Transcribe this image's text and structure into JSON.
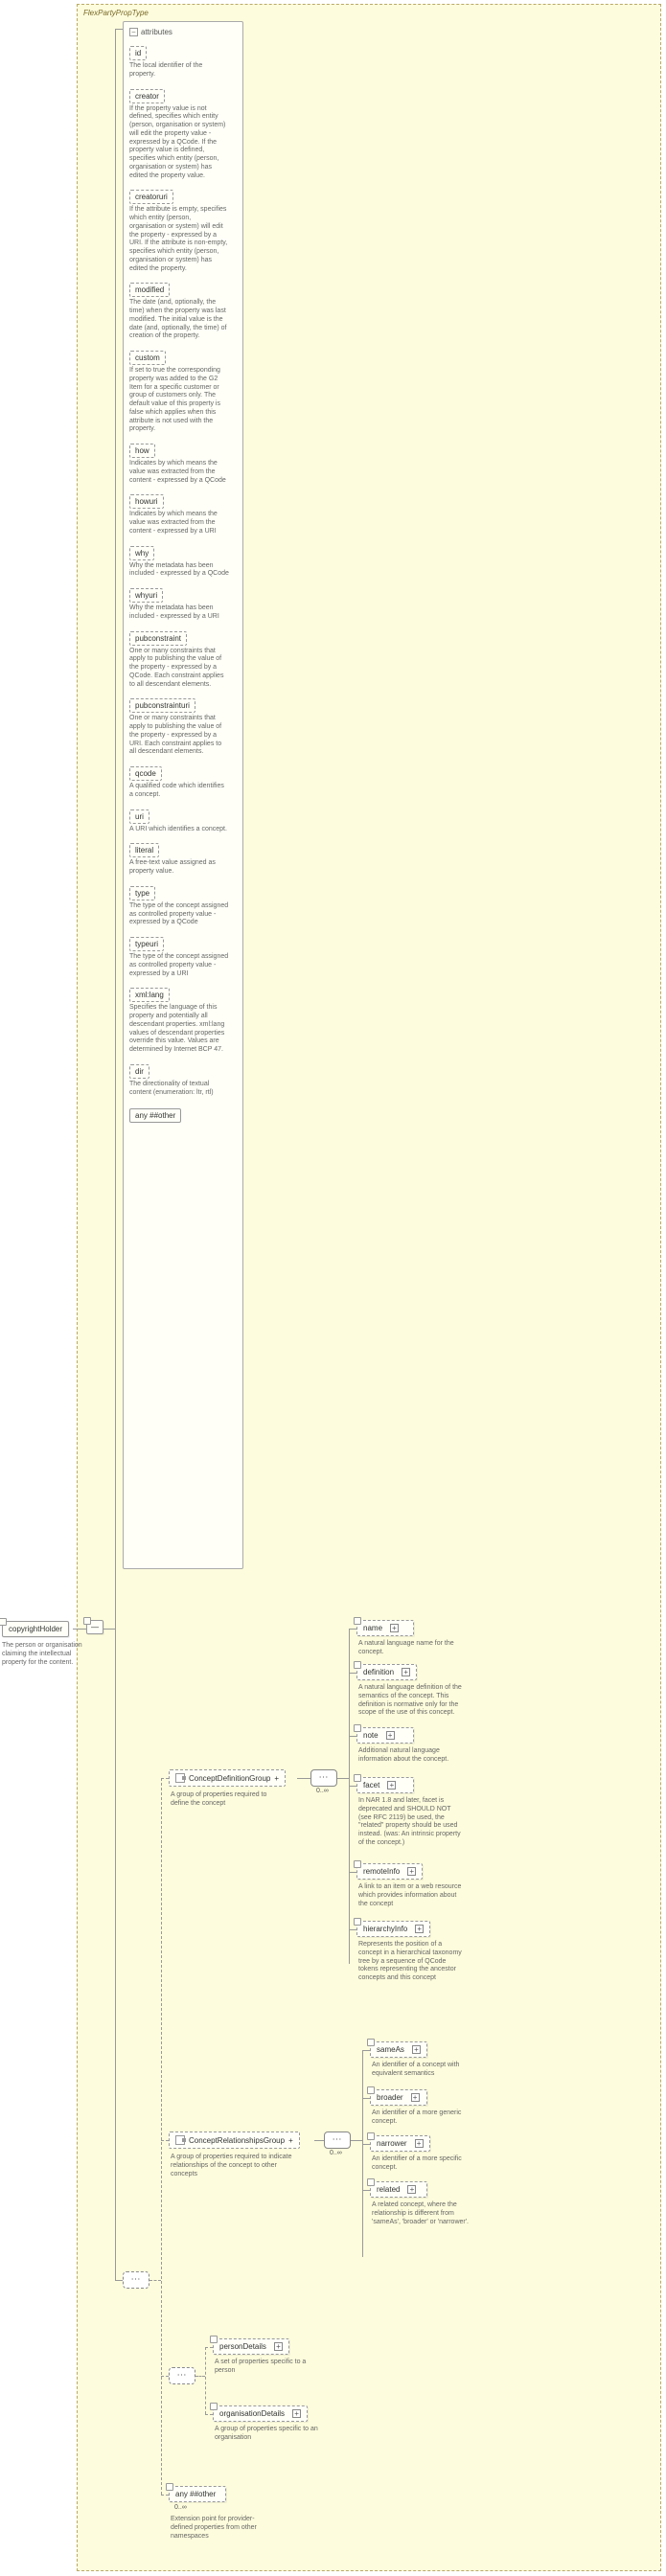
{
  "type_name": "FlexPartyPropType",
  "root": {
    "name": "copyrightHolder",
    "desc": "The person or organisation claiming the intellectual property for the content."
  },
  "attrs_header": "attributes",
  "attributes": [
    {
      "name": "id",
      "desc": "The local identifier of the property."
    },
    {
      "name": "creator",
      "desc": "If the property value is not defined, specifies which entity (person, organisation or system) will edit the property value - expressed by a QCode. If the property value is defined, specifies which entity (person, organisation or system) has edited the property value."
    },
    {
      "name": "creatoruri",
      "desc": "If the attribute is empty, specifies which entity (person, organisation or system) will edit the property - expressed by a URI. If the attribute is non-empty, specifies which entity (person, organisation or system) has edited the property."
    },
    {
      "name": "modified",
      "desc": "The date (and, optionally, the time) when the property was last modified. The initial value is the date (and, optionally, the time) of creation of the property."
    },
    {
      "name": "custom",
      "desc": "If set to true the corresponding property was added to the G2 Item for a specific customer or group of customers only. The default value of this property is false which applies when this attribute is not used with the property."
    },
    {
      "name": "how",
      "desc": "Indicates by which means the value was extracted from the content - expressed by a QCode"
    },
    {
      "name": "howuri",
      "desc": "Indicates by which means the value was extracted from the content - expressed by a URI"
    },
    {
      "name": "why",
      "desc": "Why the metadata has been included - expressed by a QCode"
    },
    {
      "name": "whyuri",
      "desc": "Why the metadata has been included - expressed by a URI"
    },
    {
      "name": "pubconstraint",
      "desc": "One or many constraints that apply to publishing the value of the property - expressed by a QCode. Each constraint applies to all descendant elements."
    },
    {
      "name": "pubconstrainturi",
      "desc": "One or many constraints that apply to publishing the value of the property - expressed by a URI. Each constraint applies to all descendant elements."
    },
    {
      "name": "qcode",
      "desc": "A qualified code which identifies a concept."
    },
    {
      "name": "uri",
      "desc": "A URI which identifies a concept."
    },
    {
      "name": "literal",
      "desc": "A free-text value assigned as property value."
    },
    {
      "name": "type",
      "desc": "The type of the concept assigned as controlled property value - expressed by a QCode"
    },
    {
      "name": "typeuri",
      "desc": "The type of the concept assigned as controlled property value - expressed by a URI"
    },
    {
      "name": "xml:lang",
      "desc": "Specifies the language of this property and potentially all descendant properties. xml:lang values of descendant properties override this value. Values are determined by Internet BCP 47."
    },
    {
      "name": "dir",
      "desc": "The directionality of textual content (enumeration: ltr, rtl)"
    }
  ],
  "attr_any": "any ##other",
  "groups": {
    "cdg": {
      "name": "ConceptDefinitionGroup",
      "desc": "A group of properties required to define the concept"
    },
    "crg": {
      "name": "ConceptRelationshipsGroup",
      "desc": "A group of properties required to indicate relationships of the concept to other concepts"
    }
  },
  "cdg_children": [
    {
      "name": "name",
      "desc": "A natural language name for the concept."
    },
    {
      "name": "definition",
      "desc": "A natural language definition of the semantics of the concept. This definition is normative only for the scope of the use of this concept."
    },
    {
      "name": "note",
      "desc": "Additional natural language information about the concept."
    },
    {
      "name": "facet",
      "desc": "In NAR 1.8 and later, facet is deprecated and SHOULD NOT (see RFC 2119) be used, the \"related\" property should be used instead. (was: An intrinsic property of the concept.)"
    },
    {
      "name": "remoteInfo",
      "desc": "A link to an item or a web resource which provides information about the concept"
    },
    {
      "name": "hierarchyInfo",
      "desc": "Represents the position of a concept in a hierarchical taxonomy tree by a sequence of QCode tokens representing the ancestor concepts and this concept"
    }
  ],
  "crg_children": [
    {
      "name": "sameAs",
      "desc": "An identifier of a concept with equivalent semantics"
    },
    {
      "name": "broader",
      "desc": "An identifier of a more generic concept."
    },
    {
      "name": "narrower",
      "desc": "An identifier of a more specific concept."
    },
    {
      "name": "related",
      "desc": "A related concept, where the relationship is different from 'sameAs', 'broader' or 'narrower'."
    }
  ],
  "extra": {
    "person": {
      "name": "personDetails",
      "desc": "A set of properties specific to a person"
    },
    "org": {
      "name": "organisationDetails",
      "desc": "A group of properties specific to an organisation"
    },
    "any": {
      "name": "any ##other",
      "desc": "Extension point for provider-defined properties from other namespaces"
    }
  },
  "occ": "0..∞"
}
